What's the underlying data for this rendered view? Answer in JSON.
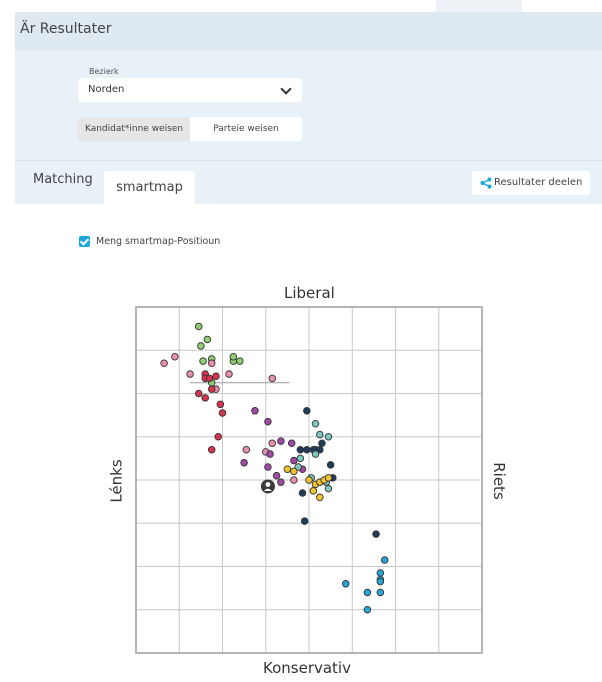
{
  "header": {
    "title": "Är Resultater"
  },
  "filters": {
    "district_label": "Bezierk",
    "district_value": "Norden",
    "toggle": {
      "candidates": "Kandidat*inne weisen",
      "parties": "Parteie weisen",
      "active": "candidates"
    }
  },
  "tabs": [
    {
      "label": "Matching",
      "active": false
    },
    {
      "label": "smartmap",
      "active": true
    }
  ],
  "share": {
    "label": "Resultater deelen",
    "icon": "share-icon"
  },
  "smartmap": {
    "checkbox_label": "Meng smartmap-Positioun",
    "checked": true
  },
  "chart_data": {
    "type": "scatter",
    "axes": {
      "top": "Liberal",
      "bottom": "Konservativ",
      "left": "Lénks",
      "right": "Riets"
    },
    "xlim": [
      0,
      8
    ],
    "ylim": [
      0,
      8
    ],
    "grid": true,
    "user_position": [
      3.05,
      3.85
    ],
    "series": [
      {
        "color": "#8fcf72",
        "points": [
          [
            1.45,
            7.55
          ],
          [
            1.65,
            7.25
          ],
          [
            1.5,
            7.1
          ],
          [
            1.75,
            6.8
          ],
          [
            1.55,
            6.75
          ],
          [
            2.25,
            6.75
          ],
          [
            2.4,
            6.75
          ],
          [
            2.25,
            6.85
          ],
          [
            1.75,
            6.25
          ]
        ]
      },
      {
        "color": "#ec8fae",
        "points": [
          [
            0.65,
            6.7
          ],
          [
            0.9,
            6.85
          ],
          [
            1.25,
            6.45
          ],
          [
            1.75,
            6.7
          ],
          [
            2.15,
            6.45
          ],
          [
            3.15,
            6.35
          ],
          [
            1.85,
            6.1
          ],
          [
            3.15,
            4.85
          ],
          [
            3.0,
            4.65
          ],
          [
            2.55,
            4.7
          ],
          [
            3.65,
            4.0
          ]
        ]
      },
      {
        "color": "#d6334d",
        "points": [
          [
            1.6,
            6.45
          ],
          [
            1.6,
            6.35
          ],
          [
            1.7,
            6.35
          ],
          [
            1.85,
            6.4
          ],
          [
            1.75,
            6.1
          ],
          [
            1.45,
            6.0
          ],
          [
            1.6,
            5.9
          ],
          [
            1.95,
            5.75
          ],
          [
            2.0,
            5.55
          ],
          [
            1.9,
            5.0
          ],
          [
            1.75,
            4.7
          ]
        ]
      },
      {
        "color": "#a04aa6",
        "points": [
          [
            2.75,
            5.6
          ],
          [
            3.05,
            5.35
          ],
          [
            3.35,
            4.9
          ],
          [
            3.6,
            4.85
          ],
          [
            2.5,
            4.4
          ],
          [
            3.05,
            4.3
          ],
          [
            3.1,
            4.6
          ],
          [
            3.25,
            4.1
          ],
          [
            3.35,
            3.95
          ],
          [
            3.65,
            4.45
          ],
          [
            3.85,
            4.25
          ]
        ]
      },
      {
        "color": "#1f3b5a",
        "points": [
          [
            3.95,
            5.6
          ],
          [
            4.3,
            4.85
          ],
          [
            3.8,
            4.7
          ],
          [
            3.95,
            4.7
          ],
          [
            4.15,
            4.7
          ],
          [
            4.1,
            4.7
          ],
          [
            4.25,
            4.7
          ],
          [
            4.5,
            4.35
          ],
          [
            4.55,
            4.05
          ],
          [
            3.85,
            3.7
          ],
          [
            3.9,
            3.05
          ],
          [
            5.55,
            2.75
          ]
        ]
      },
      {
        "color": "#7cc8c0",
        "points": [
          [
            4.15,
            5.3
          ],
          [
            4.25,
            5.05
          ],
          [
            4.45,
            5.0
          ],
          [
            4.15,
            4.6
          ],
          [
            3.75,
            4.3
          ],
          [
            3.8,
            4.5
          ],
          [
            4.4,
            3.95
          ],
          [
            4.05,
            4.05
          ],
          [
            4.45,
            3.8
          ]
        ]
      },
      {
        "color": "#f2c230",
        "points": [
          [
            3.5,
            4.25
          ],
          [
            3.65,
            4.2
          ],
          [
            4.0,
            4.0
          ],
          [
            4.15,
            3.9
          ],
          [
            4.25,
            3.95
          ],
          [
            4.35,
            4.0
          ],
          [
            4.45,
            4.05
          ],
          [
            4.25,
            3.6
          ],
          [
            4.1,
            3.75
          ]
        ]
      },
      {
        "color": "#29a4d6",
        "points": [
          [
            5.75,
            2.15
          ],
          [
            5.65,
            1.85
          ],
          [
            5.65,
            1.7
          ],
          [
            5.65,
            1.65
          ],
          [
            4.85,
            1.6
          ],
          [
            5.35,
            1.4
          ],
          [
            5.65,
            1.4
          ],
          [
            5.35,
            1.0
          ]
        ]
      }
    ],
    "mean_lines": [
      [
        1.25,
        6.25,
        3.55
      ]
    ]
  }
}
